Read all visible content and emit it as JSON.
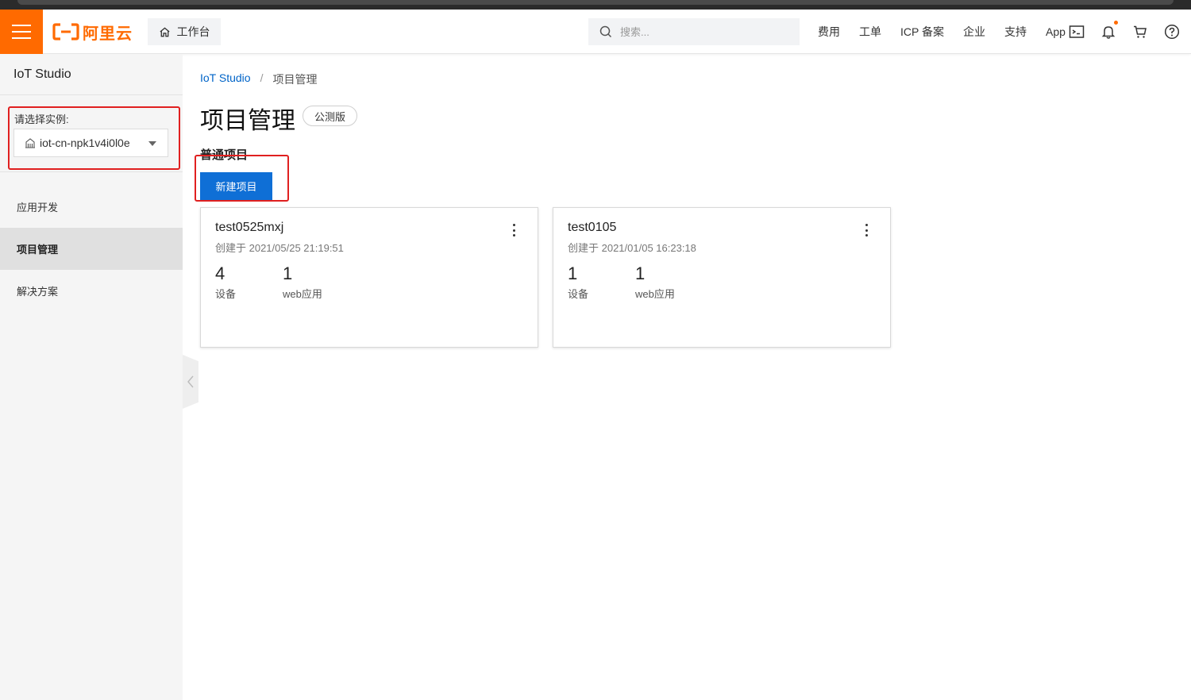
{
  "header": {
    "logo_text": "阿里云",
    "workbench_label": "工作台",
    "search_placeholder": "搜索...",
    "nav_items": [
      "费用",
      "工单",
      "ICP 备案",
      "企业",
      "支持",
      "App"
    ],
    "brand_color": "#ff6a00"
  },
  "sidebar": {
    "title": "IoT Studio",
    "instance_label": "请选择实例:",
    "instance_value": "iot-cn-npk1v4i0l0e",
    "items": [
      {
        "label": "应用开发",
        "active": false
      },
      {
        "label": "项目管理",
        "active": true
      },
      {
        "label": "解决方案",
        "active": false
      }
    ]
  },
  "main": {
    "breadcrumb": {
      "root": "IoT Studio",
      "separator": "/",
      "current": "项目管理"
    },
    "title": "项目管理",
    "badge": "公测版",
    "section_label": "普通项目",
    "new_button": "新建项目",
    "accent_color": "#0f6fd6",
    "projects": [
      {
        "name": "test0525mxj",
        "created": "创建于 2021/05/25 21:19:51",
        "devices": "4",
        "devices_label": "设备",
        "apps": "1",
        "apps_label": "web应用"
      },
      {
        "name": "test0105",
        "created": "创建于 2021/01/05 16:23:18",
        "devices": "1",
        "devices_label": "设备",
        "apps": "1",
        "apps_label": "web应用"
      }
    ]
  },
  "icons": [
    "menu-icon",
    "home-icon",
    "search-icon",
    "terminal-icon",
    "bell-icon",
    "cart-icon",
    "help-icon",
    "building-icon",
    "chevron-left-icon",
    "more-vertical-icon"
  ]
}
